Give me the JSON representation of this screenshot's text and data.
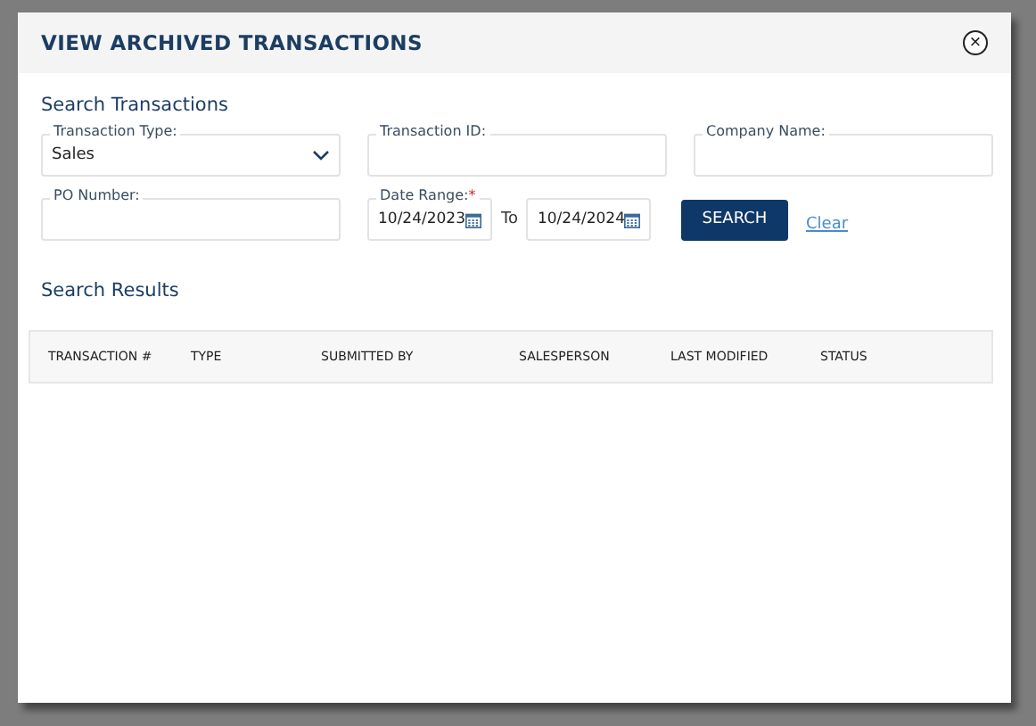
{
  "dialog": {
    "title": "VIEW ARCHIVED TRANSACTIONS",
    "close": "×"
  },
  "search": {
    "heading": "Search Transactions",
    "fields": [
      {
        "kind": "select",
        "label": "Transaction Type:",
        "value": "Sales"
      },
      {
        "kind": "text",
        "label": "Transaction ID:"
      },
      {
        "kind": "text",
        "label": "Company Name:"
      },
      {
        "kind": "text",
        "label": "PO Number:"
      }
    ],
    "date_range": {
      "label": "Date Range:",
      "required_mark": "*",
      "from": "10/24/2023",
      "separator": "To",
      "to": "10/24/2024"
    },
    "search_button": "SEARCH",
    "clear_link": "Clear"
  },
  "results": {
    "heading": "Search Results",
    "columns": [
      "TRANSACTION #",
      "TYPE",
      "SUBMITTED BY",
      "SALESPERSON",
      "LAST MODIFIED",
      "STATUS"
    ]
  }
}
